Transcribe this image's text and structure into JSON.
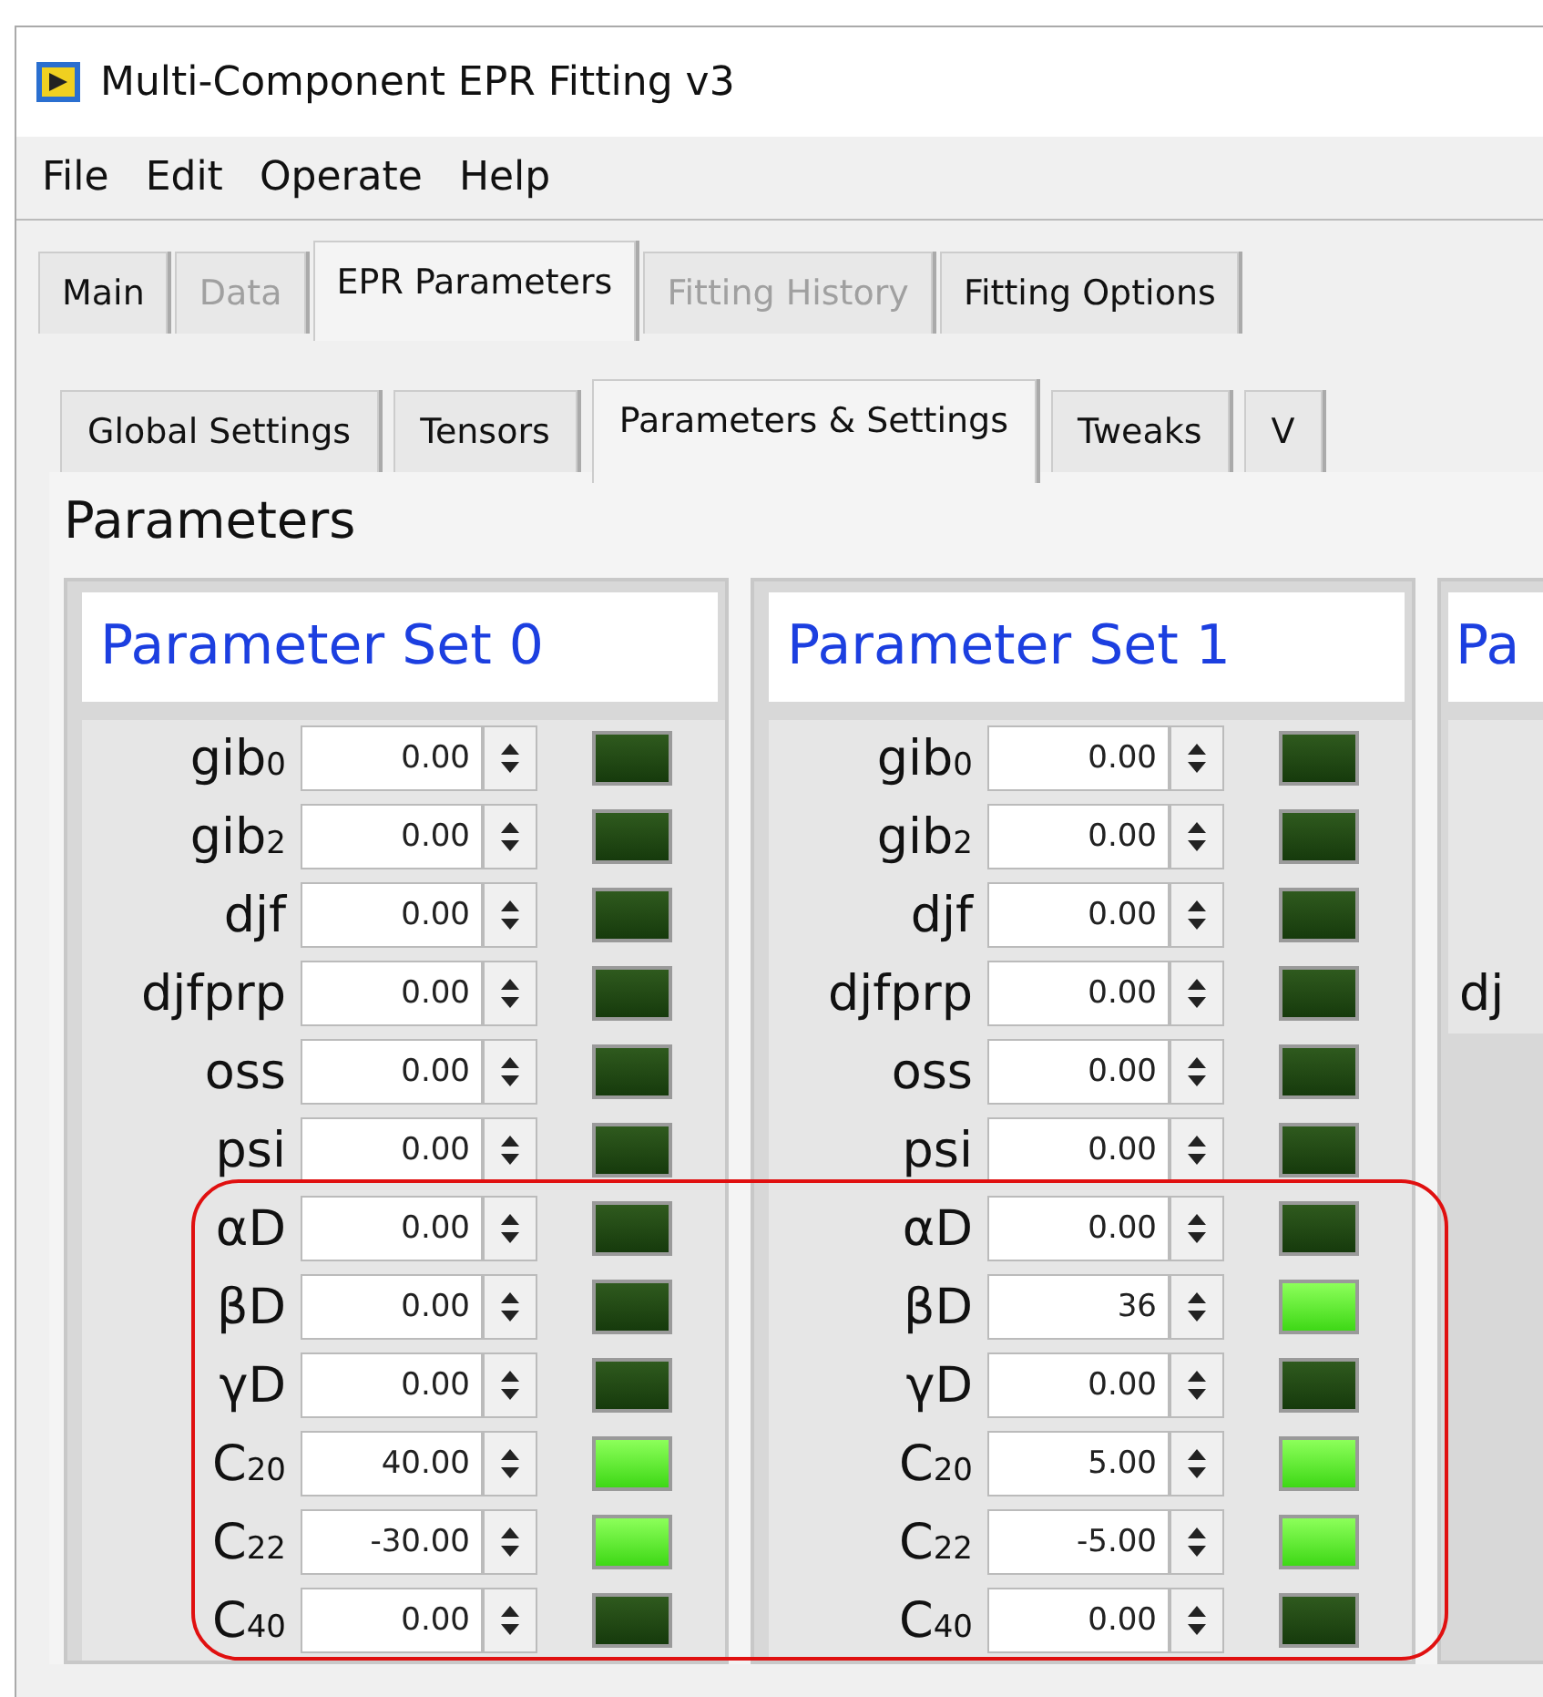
{
  "window": {
    "title": "Multi-Component EPR Fitting v3"
  },
  "menu": [
    "File",
    "Edit",
    "Operate",
    "Help"
  ],
  "tabs": [
    {
      "label": "Main",
      "selected": false,
      "disabled": false
    },
    {
      "label": "Data",
      "selected": false,
      "disabled": true
    },
    {
      "label": "EPR Parameters",
      "selected": true,
      "disabled": false
    },
    {
      "label": "Fitting History",
      "selected": false,
      "disabled": true
    },
    {
      "label": "Fitting Options",
      "selected": false,
      "disabled": false
    }
  ],
  "subtabs": [
    {
      "label": "Global Settings",
      "selected": false
    },
    {
      "label": "Tensors",
      "selected": false
    },
    {
      "label": "Parameters & Settings",
      "selected": true
    },
    {
      "label": "Tweaks",
      "selected": false
    },
    {
      "label": "V",
      "selected": false
    }
  ],
  "section_title": "Parameters",
  "parameter_sets": [
    {
      "title": "Parameter Set 0",
      "rows": [
        {
          "kind": "param",
          "label": "gib$_{0}$",
          "value": "0.00",
          "on": false
        },
        {
          "kind": "param",
          "label": "gib$_{2}$",
          "value": "0.00",
          "on": false
        },
        {
          "kind": "param",
          "label": "djf",
          "value": "0.00",
          "on": false
        },
        {
          "kind": "param",
          "label": "djfprp",
          "value": "0.00",
          "on": false
        },
        {
          "kind": "param",
          "label": "oss",
          "value": "0.00",
          "on": false
        },
        {
          "kind": "param",
          "label": "psi",
          "value": "0.00",
          "on": false
        },
        {
          "kind": "param",
          "label": "αD",
          "value": "0.00",
          "on": false
        },
        {
          "kind": "param",
          "label": "βD",
          "value": "0.00",
          "on": false
        },
        {
          "kind": "param",
          "label": "γD",
          "value": "0.00",
          "on": false
        },
        {
          "kind": "param",
          "label": "C$_{20}$",
          "value": "40.00",
          "on": true
        },
        {
          "kind": "param",
          "label": "C$_{22}$",
          "value": "-30.00",
          "on": true
        },
        {
          "kind": "param",
          "label": "C$_{40}$",
          "value": "0.00",
          "on": false
        }
      ]
    },
    {
      "title": "Parameter Set 1",
      "rows": [
        {
          "kind": "param",
          "label": "gib$_{0}$",
          "value": "0.00",
          "on": false
        },
        {
          "kind": "param",
          "label": "gib$_{2}$",
          "value": "0.00",
          "on": false
        },
        {
          "kind": "param",
          "label": "djf",
          "value": "0.00",
          "on": false
        },
        {
          "kind": "param",
          "label": "djfprp",
          "value": "0.00",
          "on": false
        },
        {
          "kind": "param",
          "label": "oss",
          "value": "0.00",
          "on": false
        },
        {
          "kind": "param",
          "label": "psi",
          "value": "0.00",
          "on": false
        },
        {
          "kind": "param",
          "label": "αD",
          "value": "0.00",
          "on": false
        },
        {
          "kind": "param",
          "label": "βD",
          "value": "36",
          "on": true
        },
        {
          "kind": "param",
          "label": "γD",
          "value": "0.00",
          "on": false
        },
        {
          "kind": "param",
          "label": "C$_{20}$",
          "value": "5.00",
          "on": true
        },
        {
          "kind": "param",
          "label": "C$_{22}$",
          "value": "-5.00",
          "on": true
        },
        {
          "kind": "param",
          "label": "C$_{40}$",
          "value": "0.00",
          "on": false
        }
      ]
    },
    {
      "title": "Pa",
      "rows": [
        {
          "kind": "empty"
        },
        {
          "kind": "empty"
        },
        {
          "kind": "empty"
        },
        {
          "kind": "label",
          "label": "dj"
        }
      ]
    }
  ]
}
